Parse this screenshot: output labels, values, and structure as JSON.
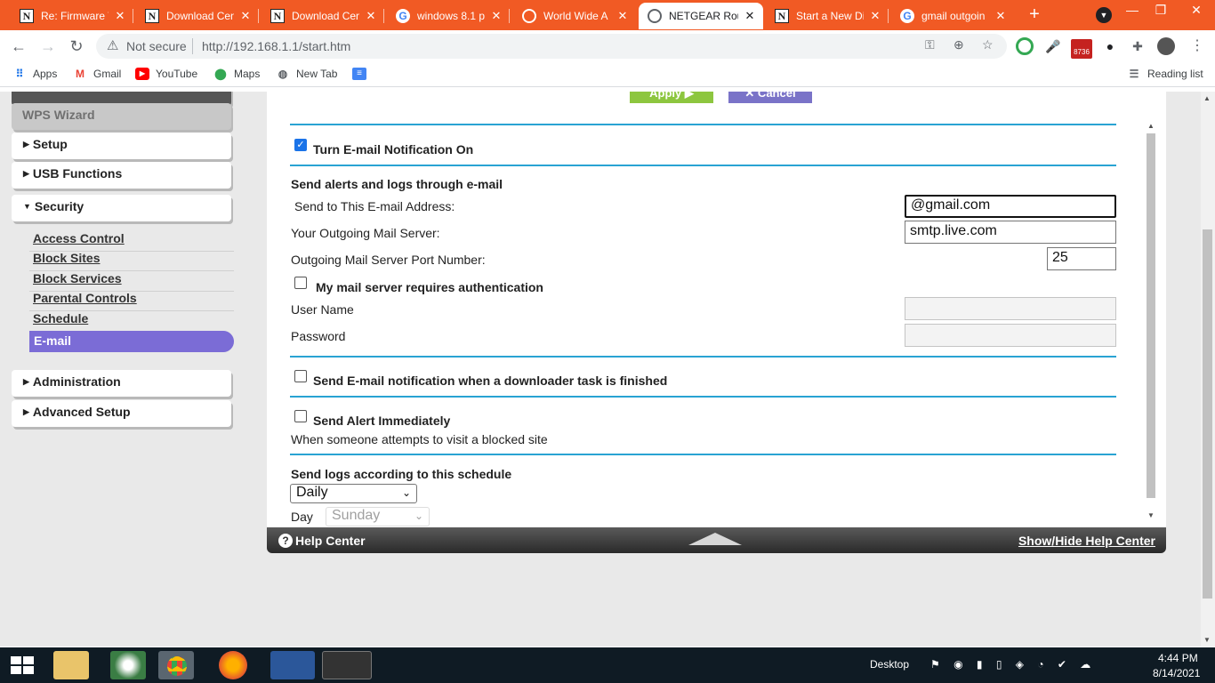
{
  "browser": {
    "tabs": [
      {
        "title": "Re: Firmware V",
        "favicon": "N"
      },
      {
        "title": "Download Cen",
        "favicon": "N"
      },
      {
        "title": "Download Cen",
        "favicon": "N"
      },
      {
        "title": "windows 8.1 p",
        "favicon": "G"
      },
      {
        "title": "World Wide A",
        "favicon": "globe"
      },
      {
        "title": "NETGEAR Rou",
        "favicon": "globe",
        "active": true
      },
      {
        "title": "Start a New Di",
        "favicon": "N"
      },
      {
        "title": "gmail outgoin",
        "favicon": "G"
      }
    ],
    "new_tab": "+",
    "security_label": "Not secure",
    "url": "http://192.168.1.1/start.htm",
    "ext_badge": "8736",
    "bookmarks": [
      {
        "label": "Apps",
        "icon": "apps-grid-icon"
      },
      {
        "label": "Gmail",
        "icon": "gmail-icon"
      },
      {
        "label": "YouTube",
        "icon": "youtube-icon"
      },
      {
        "label": "Maps",
        "icon": "maps-icon"
      },
      {
        "label": "New Tab",
        "icon": "globe-icon"
      }
    ],
    "reading_list": "Reading list"
  },
  "sidebar": {
    "wps_wizard": "WPS Wizard",
    "setup": "Setup",
    "usb_functions": "USB Functions",
    "security": "Security",
    "security_items": [
      "Access Control",
      "Block Sites",
      "Block Services",
      "Parental Controls",
      "Schedule"
    ],
    "email": "E-mail",
    "administration": "Administration",
    "advanced_setup": "Advanced Setup"
  },
  "form": {
    "apply": "Apply ▶",
    "cancel": "✕ Cancel",
    "turn_on_label": "Turn E-mail Notification On",
    "turn_on_checked": true,
    "section_title": "Send alerts and logs through e-mail",
    "email_address_label": "Send to This E-mail Address:",
    "email_address_value": "@gmail.com",
    "mail_server_label": "Your Outgoing Mail Server:",
    "mail_server_value": "smtp.live.com",
    "port_label": "Outgoing Mail Server Port Number:",
    "port_value": "25",
    "auth_label": "My mail server requires authentication",
    "username_label": "User Name",
    "password_label": "Password",
    "downloader_label": "Send E-mail notification when a downloader task is finished",
    "alert_label": "Send Alert Immediately",
    "alert_desc": "When someone attempts to visit a blocked site",
    "schedule_label": "Send logs according to this schedule",
    "schedule_value": "Daily",
    "day_label": "Day",
    "day_value": "Sunday"
  },
  "help": {
    "label": "Help Center",
    "toggle": "Show/Hide Help Center"
  },
  "taskbar": {
    "desktop": "Desktop",
    "time": "4:44 PM",
    "date": "8/14/2021"
  },
  "colors": {
    "tab_strip": "#f15a24",
    "accent_blue": "#29a3d3",
    "selected_menu": "#7b6cd6",
    "apply_green": "#8dc63f"
  }
}
